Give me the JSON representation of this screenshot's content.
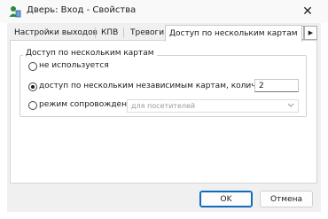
{
  "window": {
    "title": "Дверь: Вход - Свойства",
    "close_label": "✕"
  },
  "tabs": [
    {
      "label": "Настройки выходов"
    },
    {
      "label": "КПВ"
    },
    {
      "label": "Тревоги"
    },
    {
      "label": "Доступ по нескольким картам"
    }
  ],
  "tab_scroll": {
    "left": "◀",
    "right": "▶"
  },
  "group": {
    "title": "Доступ по нескольким картам",
    "options": [
      {
        "label": "не используется",
        "checked": false
      },
      {
        "label": "доступ по нескольким независимым картам, количество:",
        "checked": true
      },
      {
        "label": "режим сопровождения:",
        "checked": false
      }
    ],
    "count_value": "2",
    "mode_value": "для посетителей"
  },
  "buttons": {
    "ok": "OK",
    "cancel": "Отмена"
  },
  "colors": {
    "accent": "#0f6cbd",
    "dialog_bg": "#f0f0f0",
    "panel_bg": "#ffffff"
  },
  "icons": {
    "app": "door-user-icon",
    "close": "close-icon",
    "dropdown": "chevron-down-icon"
  }
}
